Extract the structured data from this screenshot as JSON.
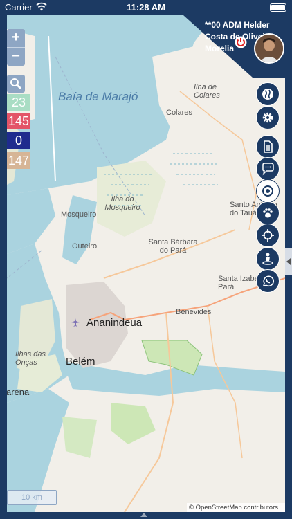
{
  "status_bar": {
    "carrier": "Carrier",
    "time": "11:28 AM"
  },
  "user": {
    "name": "**00 ADM Helder Costa de Oliveira Morelia"
  },
  "counters": [
    {
      "value": "23",
      "color": "#a9ddc4"
    },
    {
      "value": "145",
      "color": "#e35467"
    },
    {
      "value": "0",
      "color": "#1f2b8e"
    },
    {
      "value": "147",
      "color": "#d6b596"
    }
  ],
  "map": {
    "labels": {
      "bay": "Baía de Marajó",
      "ilha_colares": "Ilha de Colares",
      "colares": "Colares",
      "ilha_mosqueiro": "Ilha do Mosqueiro",
      "mosqueiro": "Mosqueiro",
      "santa_barbara": "Santa Bárbara do Pará",
      "santo_antonio": "Santo Antônio do Tauá",
      "outeiro": "Outeiro",
      "benevides": "Benevides",
      "santa_izabel": "Santa Izabel do Pará",
      "ananindeua": "Ananindeua",
      "ilhas_oncas": "Ilhas das Onças",
      "belem": "Belém",
      "barcarena": "arena"
    },
    "scale": "10 km",
    "attribution": "© OpenStreetMap contributors."
  },
  "colors": {
    "navy": "#1c3a63",
    "water": "#aad3df",
    "land": "#f2efe9",
    "forest": "#cde7b6"
  },
  "fab_icons": [
    "globe-icon",
    "gear-icon",
    "document-icon",
    "chat-icon",
    "target-icon",
    "paw-icon",
    "crosshair-icon",
    "person-pin-icon",
    "whatsapp-icon"
  ]
}
